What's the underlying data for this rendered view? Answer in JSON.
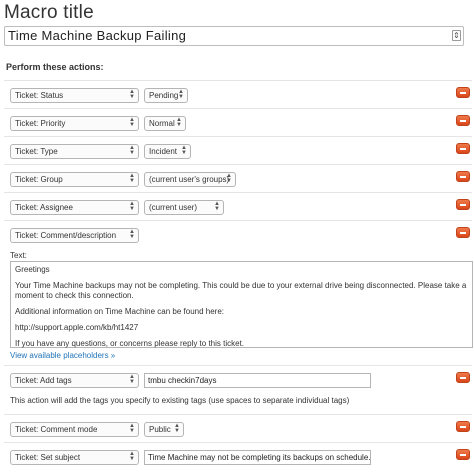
{
  "macro": {
    "heading": "Macro title",
    "title_value": "Time Machine Backup Failing",
    "expand_glyph": "⇕"
  },
  "section_heading": "Perform these actions:",
  "actions": [
    {
      "field": "Ticket: Status",
      "value": "Pending"
    },
    {
      "field": "Ticket: Priority",
      "value": "Normal"
    },
    {
      "field": "Ticket: Type",
      "value": "Incident"
    },
    {
      "field": "Ticket: Group",
      "value": "(current user's groups)"
    },
    {
      "field": "Ticket: Assignee",
      "value": "(current user)"
    },
    {
      "field": "Ticket: Comment/description"
    },
    {
      "field": "Ticket: Add tags",
      "value": "tmbu checkin7days"
    },
    {
      "field": "Ticket: Comment mode",
      "value": "Public"
    },
    {
      "field": "Ticket: Set subject",
      "value": "Time Machine may not be completing its backups on schedule."
    }
  ],
  "comment": {
    "label": "Text:",
    "paragraphs": [
      "Greetings",
      "Your Time Machine backups may not be completing. This could be due to your external drive being disconnected. Please take a moment to check this connection.",
      "Additional information on Time Machine can be found here:",
      "http://support.apple.com/kb/ht1427",
      "If you have any questions, or concerns please reply to this ticket."
    ],
    "placeholders_link": "View available placeholders »"
  },
  "tags_note": "This action will add the tags you specify to existing tags (use spaces to separate individual tags)",
  "icons": {
    "select_arrows": "▲▼",
    "remove": "minus-icon"
  }
}
